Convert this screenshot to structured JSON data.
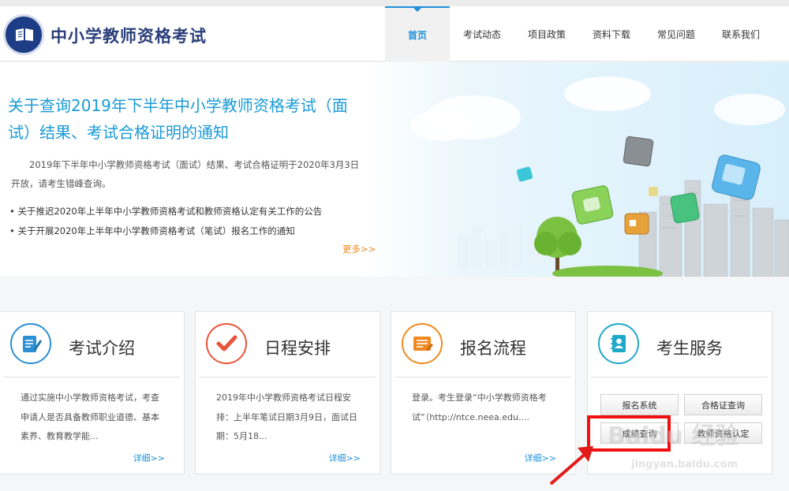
{
  "header": {
    "site_title": "中小学教师资格考试",
    "nav": [
      "首页",
      "考试动态",
      "项目政策",
      "资料下载",
      "常见问题",
      "联系我们"
    ]
  },
  "banner": {
    "title": "关于查询2019年下半年中小学教师资格考试（面试）结果、考试合格证明的通知",
    "summary": "2019年下半年中小学教师资格考试（面试）结果、考试合格证明于2020年3月3日开放，请考生错峰查询。",
    "links": [
      "关于推迟2020年上半年中小学教师资格考试和教师资格认定有关工作的公告",
      "关于开展2020年上半年中小学教师资格考试（笔试）报名工作的通知"
    ],
    "more": "更多>>"
  },
  "cards": [
    {
      "title": "考试介绍",
      "icon": "document-edit-icon",
      "text": "通过实施中小学教师资格考试，考查申请人是否具备教师职业道德、基本素养、教育教学能...",
      "more": "详细>>"
    },
    {
      "title": "日程安排",
      "icon": "checkmark-icon",
      "text": "2019年中小学教师资格考试日程安排：上半年笔试日期3月9日，面试日期：5月18...",
      "more": "详细>>"
    },
    {
      "title": "报名流程",
      "icon": "registration-form-icon",
      "text": "登录。考生登录“中小学教师资格考试”（http://ntce.neea.edu....",
      "more": "详细>>"
    },
    {
      "title": "考生服务",
      "icon": "contact-book-icon",
      "buttons": [
        "报名系统",
        "合格证查询",
        "成绩查询",
        "教师资格认定"
      ]
    }
  ],
  "colors": {
    "brand": "#1a9ad6",
    "nav_active": "#1e8fd8",
    "more_link": "#f08a20",
    "icon_blue": "#2a8fd3",
    "icon_red": "#e9543b",
    "icon_orange": "#f08a20",
    "icon_teal": "#1fa9c9",
    "highlight": "#f01010"
  },
  "watermark": {
    "brand": "Baidu 经验",
    "url": "jingyan.baidu.com"
  }
}
